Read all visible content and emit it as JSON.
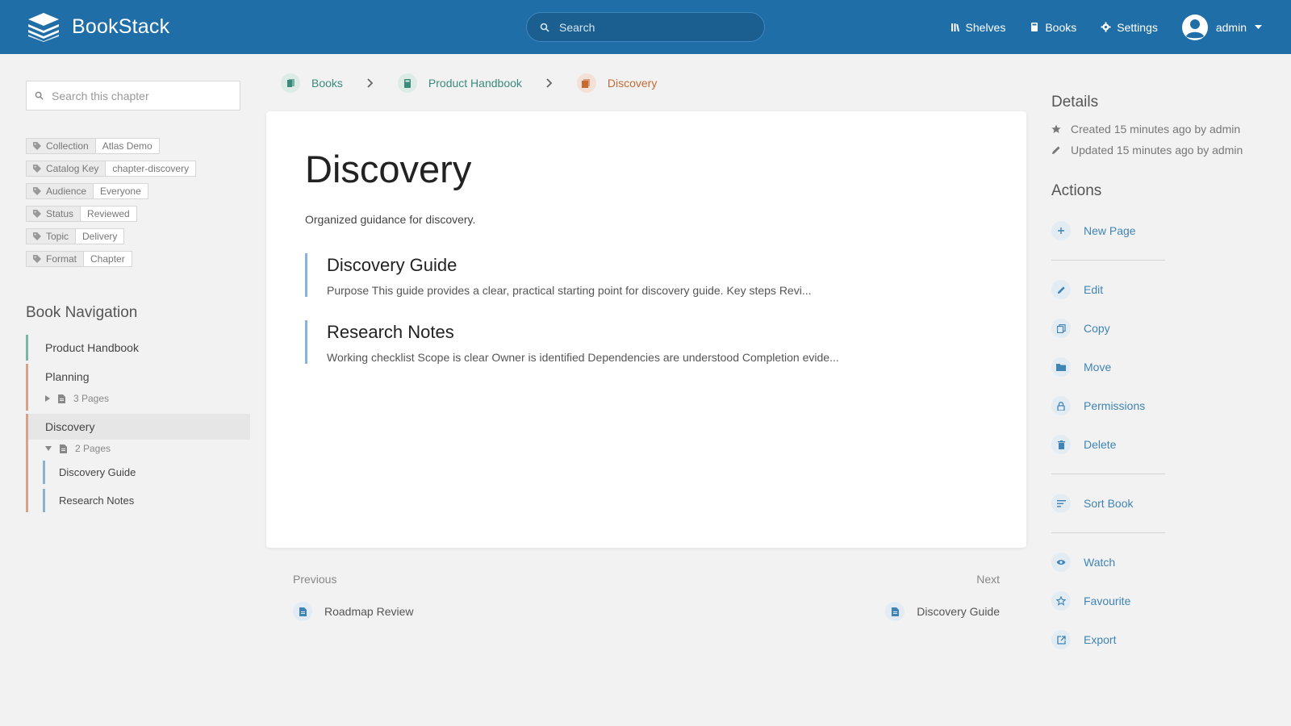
{
  "header": {
    "brand": "BookStack",
    "search_placeholder": "Search",
    "nav": {
      "shelves": "Shelves",
      "books": "Books",
      "settings": "Settings"
    },
    "user": "admin"
  },
  "sidebar": {
    "search_placeholder": "Search this chapter",
    "tags": [
      {
        "name": "Collection",
        "value": "Atlas Demo"
      },
      {
        "name": "Catalog Key",
        "value": "chapter-discovery"
      },
      {
        "name": "Audience",
        "value": "Everyone"
      },
      {
        "name": "Status",
        "value": "Reviewed"
      },
      {
        "name": "Topic",
        "value": "Delivery"
      },
      {
        "name": "Format",
        "value": "Chapter"
      }
    ],
    "nav_title": "Book Navigation",
    "book": "Product Handbook",
    "chapters": [
      {
        "title": "Planning",
        "pages_label": "3 Pages"
      },
      {
        "title": "Discovery",
        "pages_label": "2 Pages",
        "pages": [
          "Discovery Guide",
          "Research Notes"
        ]
      }
    ]
  },
  "breadcrumb": {
    "books": "Books",
    "book": "Product Handbook",
    "chapter": "Discovery"
  },
  "main": {
    "title": "Discovery",
    "description": "Organized guidance for discovery.",
    "entries": [
      {
        "title": "Discovery Guide",
        "excerpt": "Purpose This guide provides a clear, practical starting point for discovery guide. Key steps Revi..."
      },
      {
        "title": "Research Notes",
        "excerpt": "Working checklist Scope is clear Owner is identified Dependencies are understood Completion evide..."
      }
    ]
  },
  "prevnext": {
    "previous_label": "Previous",
    "previous_title": "Roadmap Review",
    "next_label": "Next",
    "next_title": "Discovery Guide"
  },
  "details": {
    "title": "Details",
    "created": "Created 15 minutes ago by admin",
    "updated": "Updated 15 minutes ago by admin"
  },
  "actions": {
    "title": "Actions",
    "new_page": "New Page",
    "edit": "Edit",
    "copy": "Copy",
    "move": "Move",
    "permissions": "Permissions",
    "delete": "Delete",
    "sort_book": "Sort Book",
    "watch": "Watch",
    "favourite": "Favourite",
    "export": "Export"
  },
  "colors": {
    "header": "#206ea7",
    "book": "#3a8b7a",
    "chapter": "#c66a34",
    "page": "#88b2d6",
    "action": "#3f84b5"
  }
}
